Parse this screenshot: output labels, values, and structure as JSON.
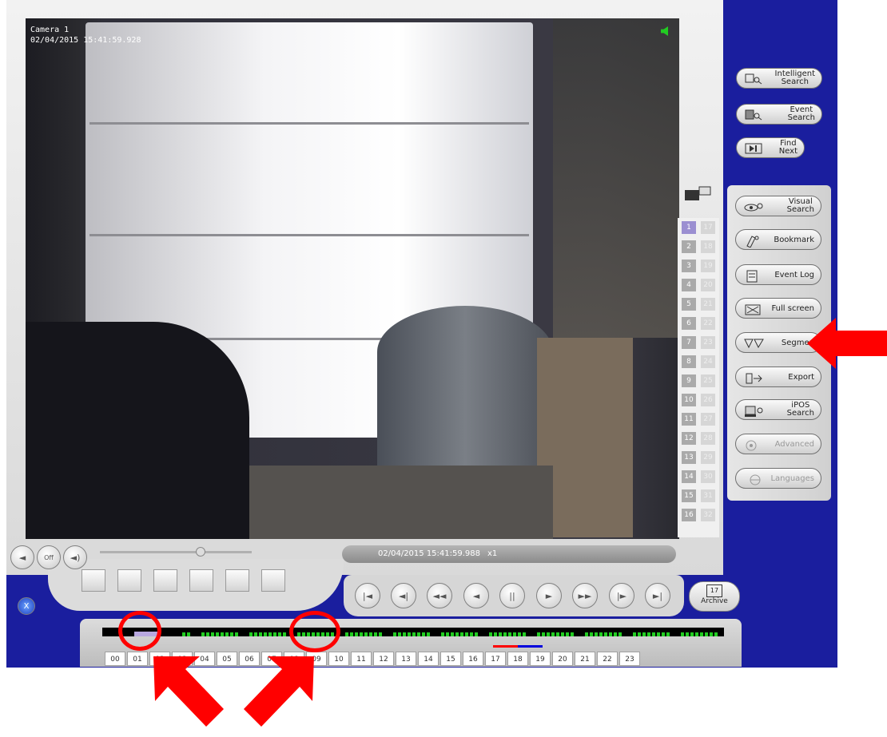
{
  "camera": {
    "name": "Camera 1",
    "timestamp": "02/04/2015 15:41:59.928"
  },
  "playback": {
    "timestamp": "02/04/2015 15:41:59.988",
    "speed": "x1"
  },
  "search_buttons": [
    {
      "name": "intelligent-search-button",
      "line1": "Intelligent",
      "line2": "Search"
    },
    {
      "name": "event-search-button",
      "line1": "Event",
      "line2": "Search"
    },
    {
      "name": "find-next-button",
      "line1": "Find",
      "line2": "Next"
    }
  ],
  "tool_buttons": [
    {
      "name": "visual-search-button",
      "line1": "Visual",
      "line2": "Search"
    },
    {
      "name": "bookmark-button",
      "line1": "Bookmark",
      "line2": ""
    },
    {
      "name": "event-log-button",
      "line1": "Event Log",
      "line2": ""
    },
    {
      "name": "full-screen-button",
      "line1": "Full screen",
      "line2": ""
    },
    {
      "name": "segment-button",
      "line1": "Segmen",
      "line2": ""
    },
    {
      "name": "export-button",
      "line1": "Export",
      "line2": ""
    },
    {
      "name": "ipos-search-button",
      "line1": "iPOS",
      "line2": "Search"
    },
    {
      "name": "advanced-button",
      "line1": "Advanced",
      "line2": ""
    },
    {
      "name": "languages-button",
      "line1": "Languages",
      "line2": ""
    }
  ],
  "camera_channels_left": [
    "1",
    "2",
    "3",
    "4",
    "5",
    "6",
    "7",
    "8",
    "9",
    "10",
    "11",
    "12",
    "13",
    "14",
    "15",
    "16"
  ],
  "camera_channels_right": [
    "17",
    "18",
    "19",
    "20",
    "21",
    "22",
    "23",
    "24",
    "25",
    "26",
    "27",
    "28",
    "29",
    "30",
    "31",
    "32"
  ],
  "selected_channel": "1",
  "archive_label": "Archive",
  "archive_day": "17",
  "volume_off_label": "Off",
  "hours": [
    "00",
    "01",
    "02",
    "03",
    "04",
    "05",
    "06",
    "07",
    "08",
    "09",
    "10",
    "11",
    "12",
    "13",
    "14",
    "15",
    "16",
    "17",
    "18",
    "19",
    "20",
    "21",
    "22",
    "23"
  ],
  "colors": {
    "app_blue": "#1a1e9e",
    "recording_green": "#22cc22",
    "annotation_red": "#ff0000",
    "selected_channel": "#9b8fd1"
  }
}
